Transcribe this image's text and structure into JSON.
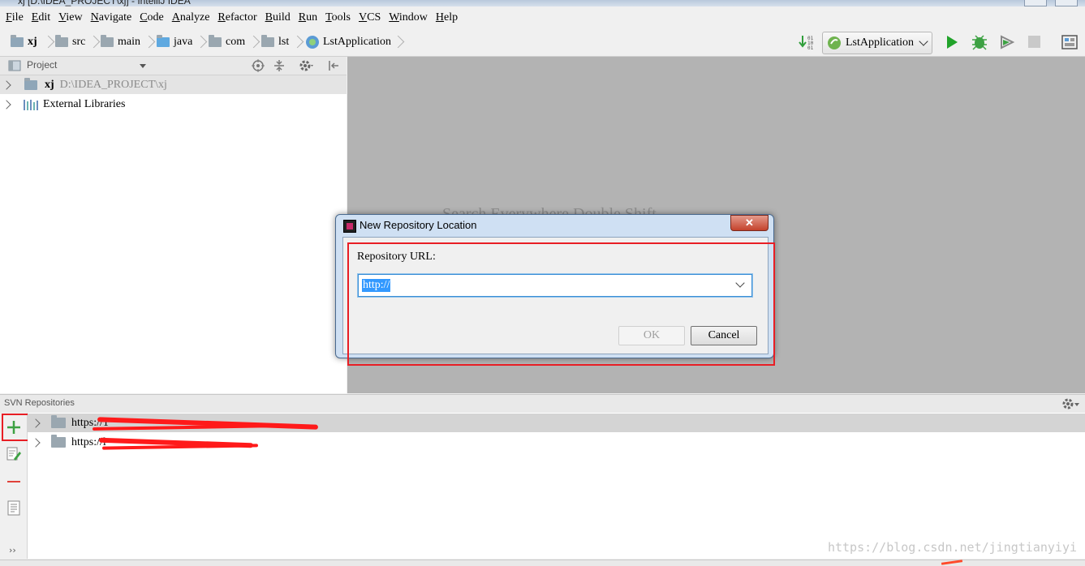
{
  "window": {
    "title": "xj [D:\\IDEA_PROJECT\\xj] - IntelliJ IDEA"
  },
  "menu": [
    "File",
    "Edit",
    "View",
    "Navigate",
    "Code",
    "Analyze",
    "Refactor",
    "Build",
    "Run",
    "Tools",
    "VCS",
    "Window",
    "Help"
  ],
  "breadcrumbs": [
    "xj",
    "src",
    "main",
    "java",
    "com",
    "lst",
    "LstApplication"
  ],
  "toolbar": {
    "run_config": "LstApplication"
  },
  "project_panel": {
    "title": "Project",
    "root": {
      "name": "xj",
      "path": "D:\\IDEA_PROJECT\\xj"
    },
    "external": "External Libraries"
  },
  "editor": {
    "hint": "Search Everywhere  Double Shift"
  },
  "svn": {
    "title": "SVN Repositories",
    "repos": [
      "https://1",
      "https://l"
    ]
  },
  "dialog": {
    "title": "New Repository Location",
    "url_label": "Repository URL:",
    "url_value": "http://",
    "ok": "OK",
    "cancel": "Cancel"
  },
  "watermark": "https://blog.csdn.net/jingtianyiyi",
  "colors": {
    "highlight_red": "#e81e25",
    "selection_blue": "#3399ff",
    "editor_bg": "#b3b3b3",
    "run_green": "#21a32a"
  },
  "icons": [
    "folder-icon",
    "module-icon",
    "library-icon",
    "spring-boot-icon",
    "run-icon",
    "debug-icon",
    "coverage-icon",
    "stop-icon",
    "gear-icon",
    "target-icon",
    "collapse-icon",
    "add-icon",
    "edit-icon",
    "remove-icon",
    "info-icon",
    "close-icon",
    "chevron-down-icon"
  ]
}
